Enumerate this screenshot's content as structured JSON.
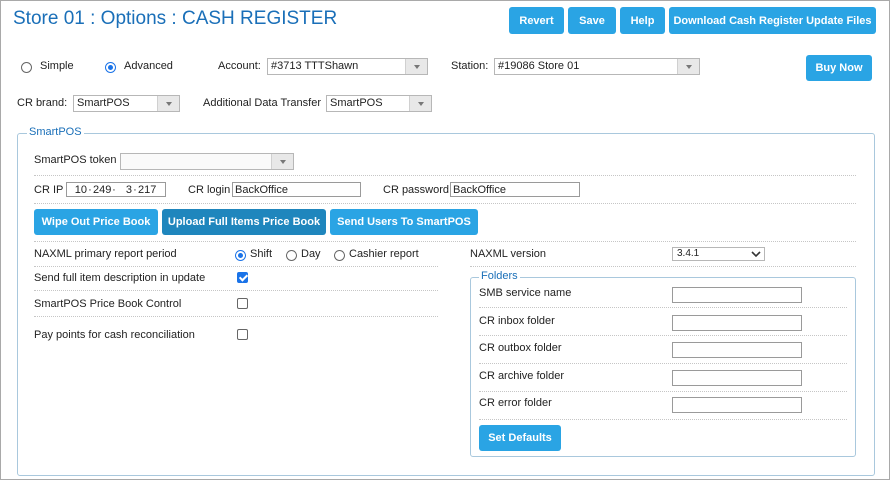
{
  "page": {
    "title": "Store 01 : Options : CASH REGISTER"
  },
  "header_buttons": {
    "revert": "Revert",
    "save": "Save",
    "help": "Help",
    "download": "Download Cash Register Update Files"
  },
  "mode": {
    "simple": "Simple",
    "advanced": "Advanced",
    "selected": "Advanced"
  },
  "account": {
    "label": "Account:",
    "value": "#3713 TTTShawn"
  },
  "station": {
    "label": "Station:",
    "value": "#19086 Store 01"
  },
  "buy_now": "Buy Now",
  "cr_brand": {
    "label": "CR brand:",
    "value": "SmartPOS"
  },
  "additional_transfer": {
    "label": "Additional Data Transfer",
    "value": "SmartPOS"
  },
  "smartpos": {
    "legend": "SmartPOS",
    "token_label": "SmartPOS token",
    "token_value": "",
    "cr_ip_label": "CR IP",
    "cr_ip": [
      "10",
      "249",
      "3",
      "217"
    ],
    "cr_login_label": "CR login",
    "cr_login": "BackOffice",
    "cr_password_label": "CR password",
    "cr_password": "BackOffice",
    "actions": {
      "wipe": "Wipe Out Price Book",
      "upload": "Upload Full Items Price Book",
      "send_users": "Send Users To SmartPOS"
    },
    "report_period": {
      "label": "NAXML primary report period",
      "options": [
        "Shift",
        "Day",
        "Cashier report"
      ],
      "selected": "Shift"
    },
    "send_full_desc": {
      "label": "Send full item description in update",
      "checked": true
    },
    "price_book_control": {
      "label": "SmartPOS Price Book Control",
      "checked": false
    },
    "pay_points": {
      "label": "Pay points for cash reconciliation",
      "checked": false
    },
    "naxml_version": {
      "label": "NAXML version",
      "value": "3.4.1"
    },
    "folders": {
      "legend": "Folders",
      "smb_label": "SMB service name",
      "inbox_label": "CR inbox folder",
      "outbox_label": "CR outbox folder",
      "archive_label": "CR archive folder",
      "error_label": "CR error folder",
      "set_defaults": "Set Defaults"
    }
  },
  "colors": {
    "accent": "#2aa4e4",
    "accent_dark": "#1f86bd",
    "title": "#1a6fb8",
    "check": "#1a73e8"
  }
}
